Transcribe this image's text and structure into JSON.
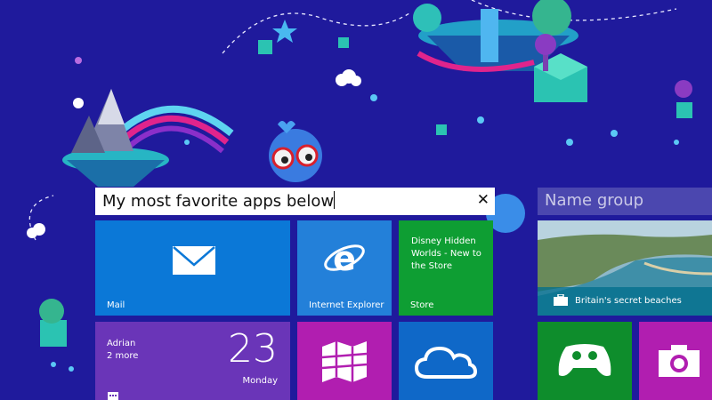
{
  "screen": "Windows Start screen",
  "group_name_input": {
    "value": "My most favorite apps below",
    "clear_glyph": "✕"
  },
  "second_group": {
    "placeholder": "Name group"
  },
  "tiles": {
    "mail": {
      "label": "Mail",
      "icon": "envelope-icon",
      "color": "#0b78d7"
    },
    "ie": {
      "label": "Internet Explorer",
      "icon": "internet-explorer-icon",
      "color": "#2380d9"
    },
    "store": {
      "label": "Store",
      "text": "Disney Hidden Worlds - New to the Store",
      "color": "#0e9e33"
    },
    "calendar": {
      "person": "Adrian",
      "more": "2 more",
      "day": "23",
      "weekday": "Monday",
      "color": "#6a35b8"
    },
    "maps": {
      "icon": "maps-icon",
      "color": "#b11eb0"
    },
    "onedrive": {
      "icon": "cloud-icon",
      "color": "#0f68c8"
    },
    "travel": {
      "caption": "Britain's secret beaches",
      "icon": "suitcase-icon"
    },
    "games": {
      "icon": "xbox-controller-icon",
      "color": "#0e8d2c"
    },
    "camera": {
      "icon": "camera-icon",
      "color": "#b11eb0"
    }
  },
  "colors": {
    "background": "#1f1a9c"
  }
}
